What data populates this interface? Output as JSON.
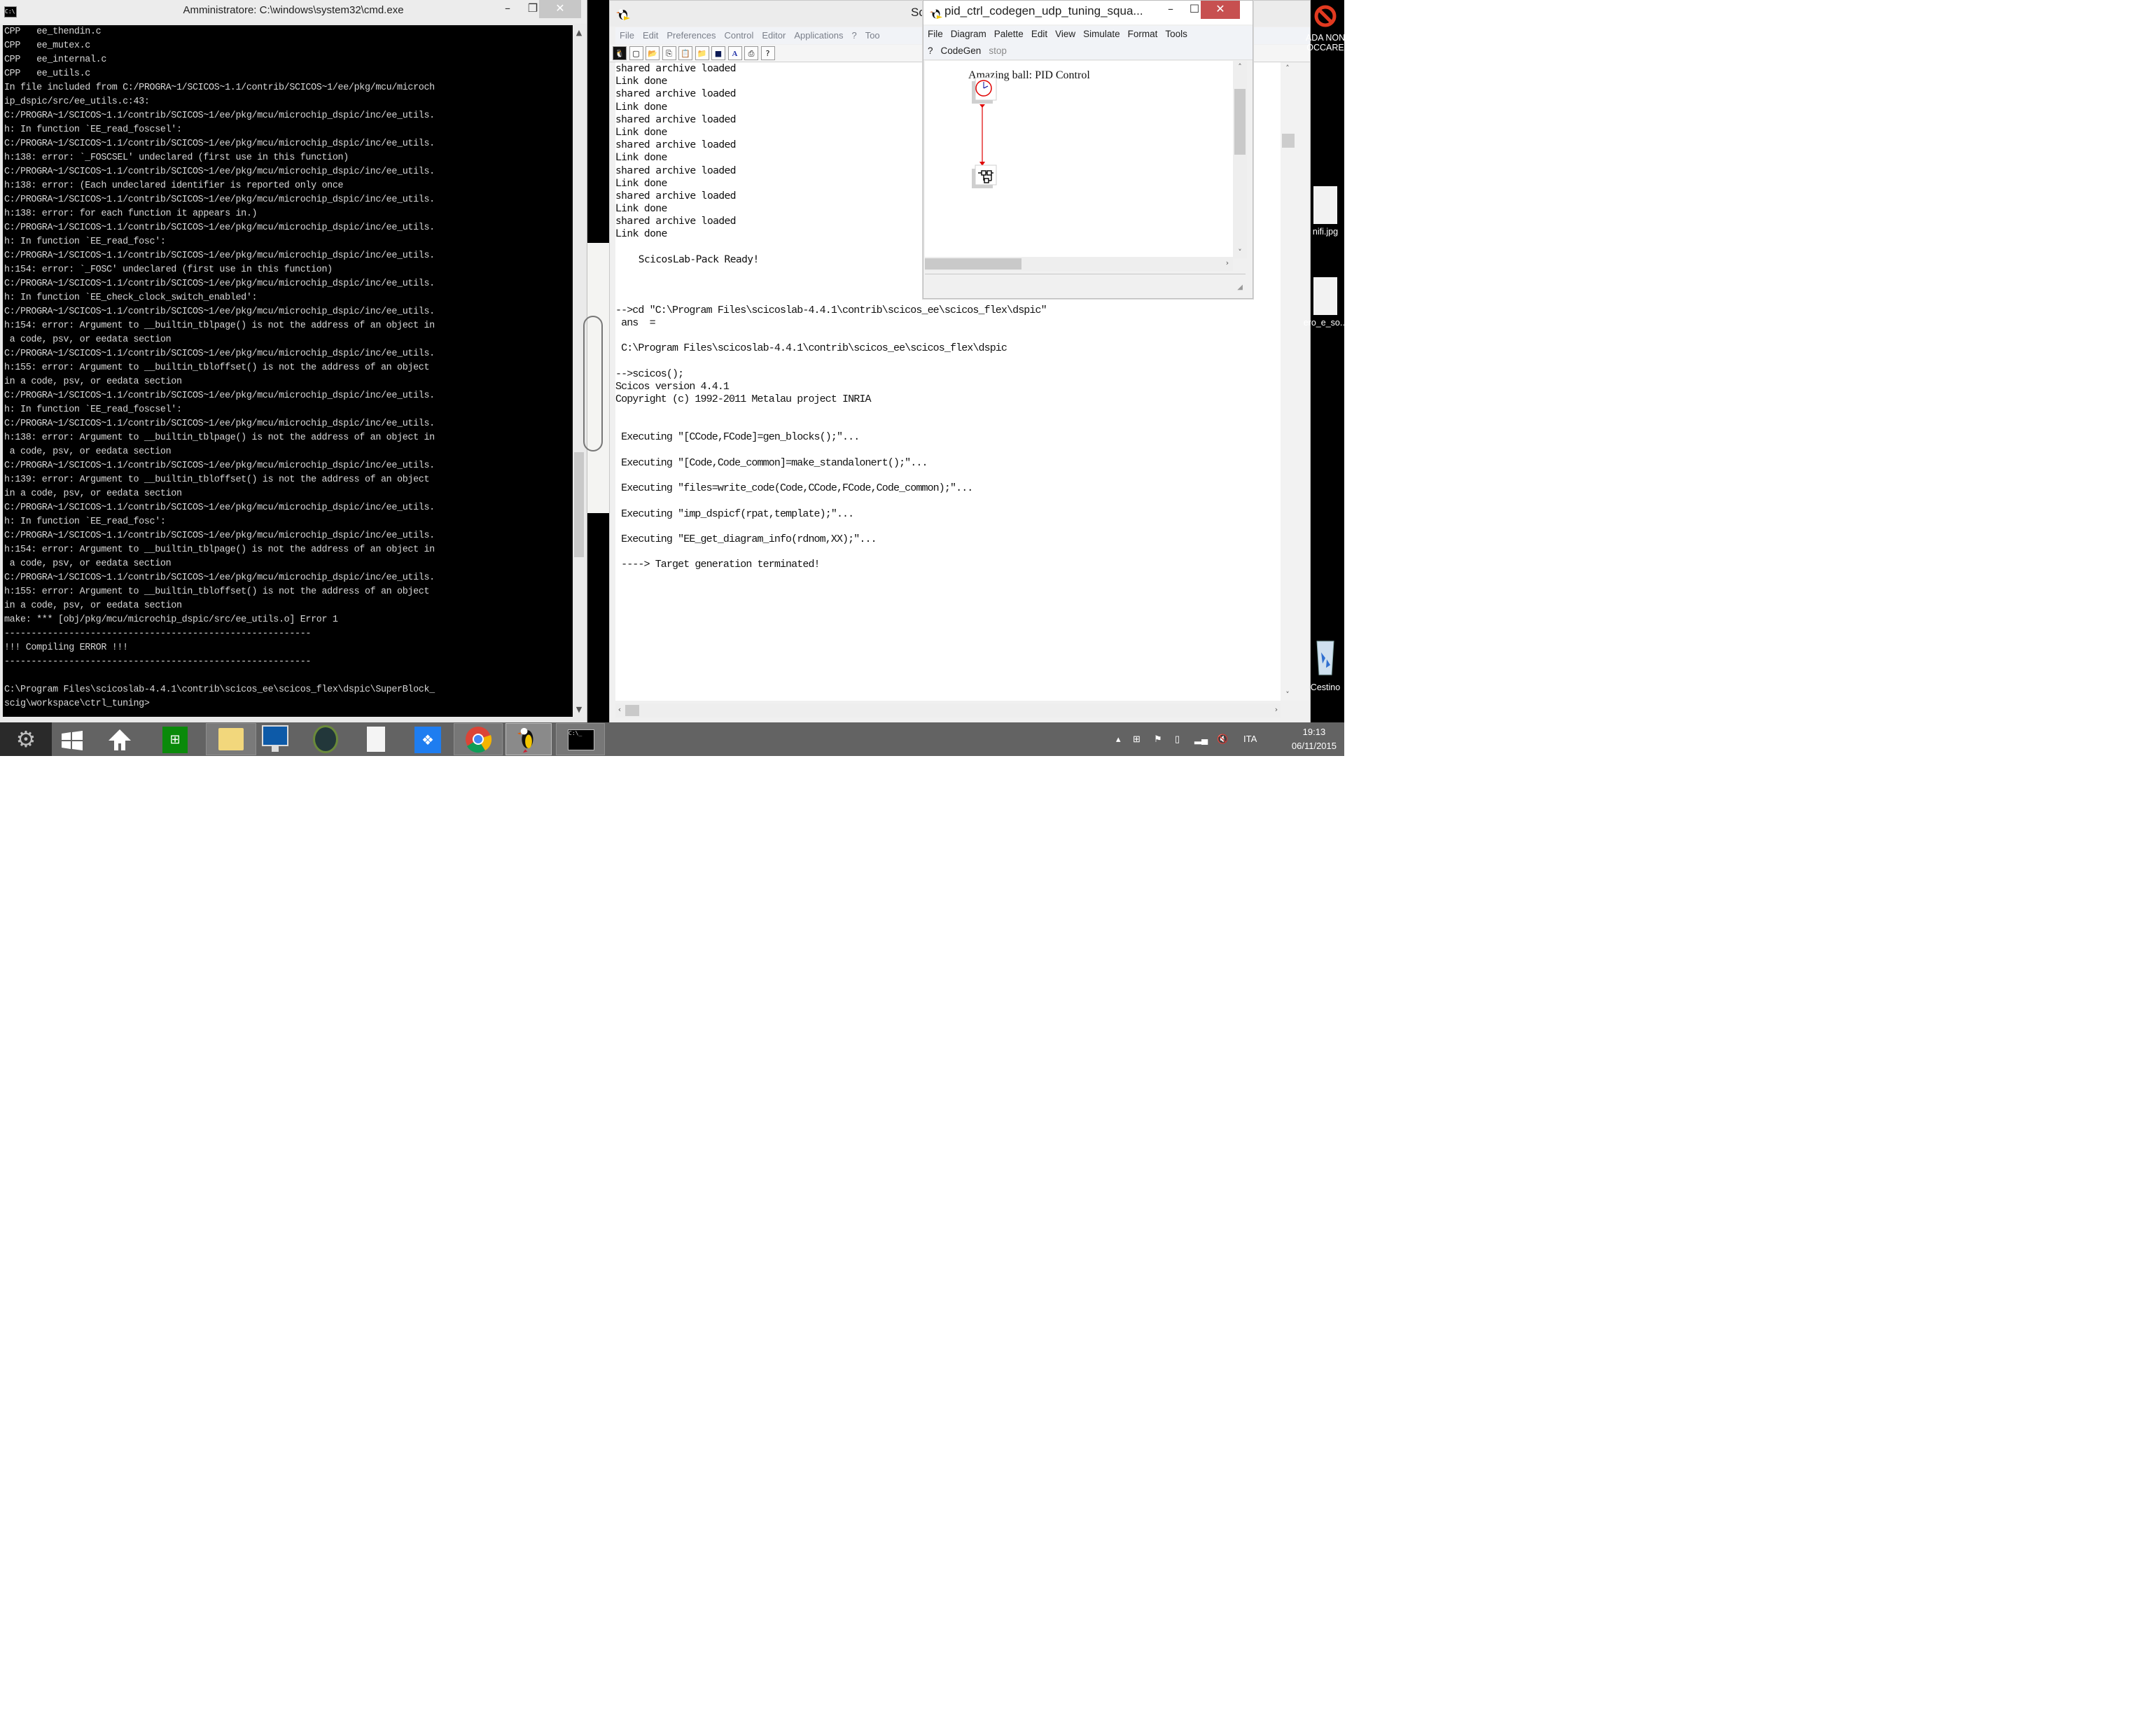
{
  "cmd_window": {
    "title": "Amministratore: C:\\windows\\system32\\cmd.exe",
    "minimize": "–",
    "maximize": "❐",
    "close": "✕",
    "lines": [
      "CPP   ee_thendin.c",
      "CPP   ee_mutex.c",
      "CPP   ee_internal.c",
      "CPP   ee_utils.c",
      "In file included from C:/PROGRA~1/SCICOS~1.1/contrib/SCICOS~1/ee/pkg/mcu/microch",
      "ip_dspic/src/ee_utils.c:43:",
      "C:/PROGRA~1/SCICOS~1.1/contrib/SCICOS~1/ee/pkg/mcu/microchip_dspic/inc/ee_utils.",
      "h: In function `EE_read_foscsel':",
      "C:/PROGRA~1/SCICOS~1.1/contrib/SCICOS~1/ee/pkg/mcu/microchip_dspic/inc/ee_utils.",
      "h:138: error: `_FOSCSEL' undeclared (first use in this function)",
      "C:/PROGRA~1/SCICOS~1.1/contrib/SCICOS~1/ee/pkg/mcu/microchip_dspic/inc/ee_utils.",
      "h:138: error: (Each undeclared identifier is reported only once",
      "C:/PROGRA~1/SCICOS~1.1/contrib/SCICOS~1/ee/pkg/mcu/microchip_dspic/inc/ee_utils.",
      "h:138: error: for each function it appears in.)",
      "C:/PROGRA~1/SCICOS~1.1/contrib/SCICOS~1/ee/pkg/mcu/microchip_dspic/inc/ee_utils.",
      "h: In function `EE_read_fosc':",
      "C:/PROGRA~1/SCICOS~1.1/contrib/SCICOS~1/ee/pkg/mcu/microchip_dspic/inc/ee_utils.",
      "h:154: error: `_FOSC' undeclared (first use in this function)",
      "C:/PROGRA~1/SCICOS~1.1/contrib/SCICOS~1/ee/pkg/mcu/microchip_dspic/inc/ee_utils.",
      "h: In function `EE_check_clock_switch_enabled':",
      "C:/PROGRA~1/SCICOS~1.1/contrib/SCICOS~1/ee/pkg/mcu/microchip_dspic/inc/ee_utils.",
      "h:154: error: Argument to __builtin_tblpage() is not the address of an object in",
      " a code, psv, or eedata section",
      "C:/PROGRA~1/SCICOS~1.1/contrib/SCICOS~1/ee/pkg/mcu/microchip_dspic/inc/ee_utils.",
      "h:155: error: Argument to __builtin_tbloffset() is not the address of an object",
      "in a code, psv, or eedata section",
      "C:/PROGRA~1/SCICOS~1.1/contrib/SCICOS~1/ee/pkg/mcu/microchip_dspic/inc/ee_utils.",
      "h: In function `EE_read_foscsel':",
      "C:/PROGRA~1/SCICOS~1.1/contrib/SCICOS~1/ee/pkg/mcu/microchip_dspic/inc/ee_utils.",
      "h:138: error: Argument to __builtin_tblpage() is not the address of an object in",
      " a code, psv, or eedata section",
      "C:/PROGRA~1/SCICOS~1.1/contrib/SCICOS~1/ee/pkg/mcu/microchip_dspic/inc/ee_utils.",
      "h:139: error: Argument to __builtin_tbloffset() is not the address of an object",
      "in a code, psv, or eedata section",
      "C:/PROGRA~1/SCICOS~1.1/contrib/SCICOS~1/ee/pkg/mcu/microchip_dspic/inc/ee_utils.",
      "h: In function `EE_read_fosc':",
      "C:/PROGRA~1/SCICOS~1.1/contrib/SCICOS~1/ee/pkg/mcu/microchip_dspic/inc/ee_utils.",
      "h:154: error: Argument to __builtin_tblpage() is not the address of an object in",
      " a code, psv, or eedata section",
      "C:/PROGRA~1/SCICOS~1.1/contrib/SCICOS~1/ee/pkg/mcu/microchip_dspic/inc/ee_utils.",
      "h:155: error: Argument to __builtin_tbloffset() is not the address of an object",
      "in a code, psv, or eedata section",
      "make: *** [obj/pkg/mcu/microchip_dspic/src/ee_utils.o] Error 1",
      "---------------------------------------------------------",
      "!!! Compiling ERROR !!!",
      "---------------------------------------------------------",
      "",
      "C:\\Program Files\\scicoslab-4.4.1\\contrib\\scicos_ee\\scicos_flex\\dspic\\SuperBlock_",
      "scig\\workspace\\ctrl_tuning>"
    ]
  },
  "scilab_window": {
    "title": "Scicos",
    "menu": [
      "File",
      "Edit",
      "Preferences",
      "Control",
      "Editor",
      "Applications",
      "?",
      "Too"
    ],
    "toolbar": [
      "scicoslab-logo-icon",
      "new-file-icon",
      "open-file-icon",
      "copy-icon",
      "paste-icon",
      "folder-icon",
      "console-icon",
      "font-icon",
      "print-icon",
      "help-icon"
    ],
    "console_lines": [
      {
        "text": "shared archive loaded",
        "style": "mono"
      },
      {
        "text": "Link done",
        "style": "mono"
      },
      {
        "text": "shared archive loaded",
        "style": "mono"
      },
      {
        "text": "Link done",
        "style": "mono"
      },
      {
        "text": "shared archive loaded",
        "style": "mono"
      },
      {
        "text": "Link done",
        "style": "mono"
      },
      {
        "text": "shared archive loaded",
        "style": "mono"
      },
      {
        "text": "Link done",
        "style": "mono"
      },
      {
        "text": "shared archive loaded",
        "style": "mono"
      },
      {
        "text": "Link done",
        "style": "mono"
      },
      {
        "text": "shared archive loaded",
        "style": "mono"
      },
      {
        "text": "Link done",
        "style": "mono"
      },
      {
        "text": "shared archive loaded",
        "style": "mono"
      },
      {
        "text": "Link done",
        "style": "mono"
      },
      {
        "text": "",
        "style": "mono"
      },
      {
        "text": "    ScicosLab-Pack Ready!",
        "style": "mono"
      },
      {
        "text": "",
        "style": "mono"
      },
      {
        "text": "",
        "style": "mono"
      },
      {
        "text": "",
        "style": "mono"
      },
      {
        "text": "-->cd \"C:\\Program Files\\scicoslab-4.4.1\\contrib\\scicos_ee\\scicos_flex\\dspic\"",
        "style": "cond"
      },
      {
        "text": " ans  =",
        "style": "cond"
      },
      {
        "text": "",
        "style": "cond"
      },
      {
        "text": " C:\\Program Files\\scicoslab-4.4.1\\contrib\\scicos_ee\\scicos_flex\\dspic",
        "style": "cond"
      },
      {
        "text": "",
        "style": "cond"
      },
      {
        "text": "-->scicos();",
        "style": "cond"
      },
      {
        "text": "Scicos version 4.4.1",
        "style": "cond"
      },
      {
        "text": "Copyright (c) 1992-2011 Metalau project INRIA",
        "style": "cond"
      },
      {
        "text": "",
        "style": "cond"
      },
      {
        "text": "",
        "style": "cond"
      },
      {
        "text": " Executing \"[CCode,FCode]=gen_blocks();\"...",
        "style": "cond"
      },
      {
        "text": "",
        "style": "cond"
      },
      {
        "text": " Executing \"[Code,Code_common]=make_standalonert();\"...",
        "style": "cond"
      },
      {
        "text": "",
        "style": "cond"
      },
      {
        "text": " Executing \"files=write_code(Code,CCode,FCode,Code_common);\"...",
        "style": "cond"
      },
      {
        "text": "",
        "style": "cond"
      },
      {
        "text": " Executing \"imp_dspicf(rpat,template);\"...",
        "style": "cond"
      },
      {
        "text": "",
        "style": "cond"
      },
      {
        "text": " Executing \"EE_get_diagram_info(rdnom,XX);\"...",
        "style": "cond"
      },
      {
        "text": "",
        "style": "cond"
      },
      {
        "text": " ----> Target generation terminated!",
        "style": "cond"
      }
    ]
  },
  "diagram_window": {
    "title": "pid_ctrl_codegen_udp_tuning_squa...",
    "minimize": "–",
    "maximize": "☐",
    "close": "✕",
    "menu": [
      "File",
      "Diagram",
      "Palette",
      "Edit",
      "View",
      "Simulate",
      "Format",
      "Tools"
    ],
    "menu2": [
      {
        "label": "?",
        "enabled": true
      },
      {
        "label": "CodeGen",
        "enabled": true
      },
      {
        "label": "stop",
        "enabled": false
      }
    ],
    "diagram_title": "Amazing ball: PID Control",
    "blocks": [
      {
        "name": "clock-block",
        "type": "SampleCLK"
      },
      {
        "name": "superblock",
        "type": "Super Block"
      }
    ],
    "link_color": "#ff0000"
  },
  "desktop": {
    "icons": [
      {
        "name": "do-not-touch-folder",
        "label": "ADA NON\nOCCARE",
        "icon": "prohibited-icon"
      },
      {
        "name": "unifi-jpg",
        "label": "nifi.jpg",
        "icon": "image-file-icon"
      },
      {
        "name": "ero-e-so-file",
        "label": "ero_e_so...",
        "icon": "image-file-icon"
      },
      {
        "name": "recycle-bin",
        "label": "Cestino",
        "icon": "recycle-bin-icon"
      }
    ]
  },
  "taskbar": {
    "apps": [
      {
        "name": "settings",
        "icon": "gear-icon"
      },
      {
        "name": "start",
        "icon": "windows-logo-icon"
      },
      {
        "name": "home",
        "icon": "home-icon"
      },
      {
        "name": "store",
        "icon": "store-icon"
      },
      {
        "name": "file-explorer",
        "icon": "folder-icon",
        "active": true
      },
      {
        "name": "lenovo",
        "icon": "monitor-icon"
      },
      {
        "name": "app-spiral",
        "icon": "spiral-icon"
      },
      {
        "name": "document",
        "icon": "document-icon"
      },
      {
        "name": "dropbox",
        "icon": "dropbox-icon"
      },
      {
        "name": "chrome",
        "icon": "chrome-icon",
        "active": true
      },
      {
        "name": "scicoslab",
        "icon": "puffin-icon",
        "active": true
      },
      {
        "name": "cmd",
        "icon": "terminal-icon",
        "active": true
      }
    ],
    "tray": {
      "language": "ITA",
      "time": "19:13",
      "date": "06/11/2015"
    }
  }
}
